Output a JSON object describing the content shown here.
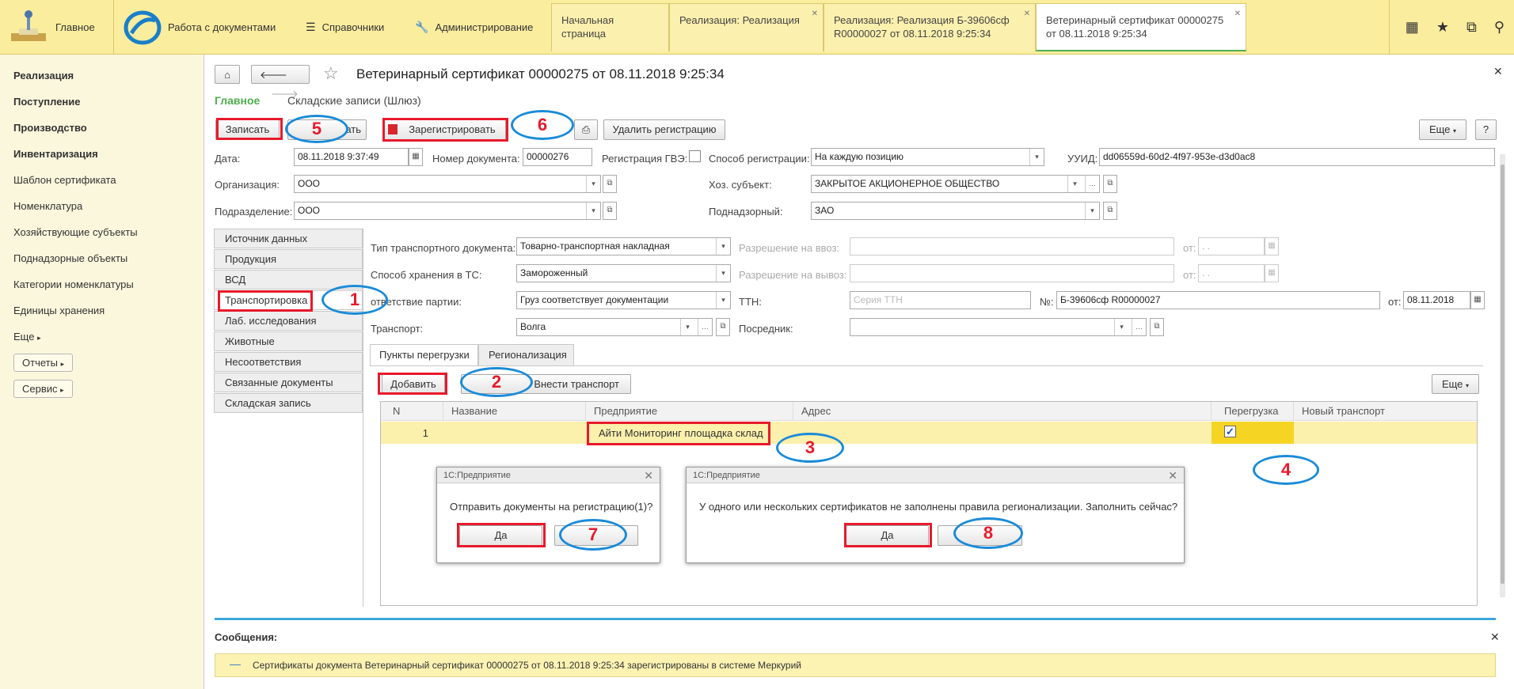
{
  "topbar": {
    "home": "Главное",
    "docs": "Работа с документами",
    "refs": "Справочники",
    "admin": "Администрирование",
    "tabs": [
      {
        "l1": "Начальная страница",
        "l2": ""
      },
      {
        "l1": "Реализация: Реализация",
        "l2": ""
      },
      {
        "l1": "Реализация: Реализация Б-39606сф",
        "l2": "R00000027 от 08.11.2018 9:25:34"
      },
      {
        "l1": "Ветеринарный сертификат 00000275",
        "l2": "от 08.11.2018 9:25:34"
      }
    ]
  },
  "leftnav": {
    "items": [
      "Реализация",
      "Поступление",
      "Производство",
      "Инвентаризация",
      "Шаблон сертификата",
      "Номенклатура",
      "Хозяйствующие субъекты",
      "Поднадзорные объекты",
      "Категории номенклатуры",
      "Единицы хранения",
      "Еще"
    ],
    "reports": "Отчеты",
    "service": "Сервис"
  },
  "form": {
    "title": "Ветеринарный сертификат 00000275 от 08.11.2018 9:25:34",
    "tab_main": "Главное",
    "tab_warehouse": "Складские записи (Шлюз)",
    "btn_write": "Записать",
    "btn_post_tail": "ать",
    "btn_register": "Зарегистрировать",
    "btn_unregister": "Удалить регистрацию",
    "btn_more": "Еще",
    "btn_help": "?",
    "date_label": "Дата:",
    "date_value": "08.11.2018  9:37:49",
    "docnum_label": "Номер документа:",
    "docnum_value": "00000276",
    "gvz_label": "Регистрация ГВЭ:",
    "regway_label": "Способ регистрации:",
    "regway_value": "На каждую позицию",
    "uuid_label": "УУИД:",
    "uuid_value": "dd06559d-60d2-4f97-953e-d3d0ac8",
    "org_label": "Организация:",
    "org_value": "ООО",
    "subject_label": "Хоз. субъект:",
    "subject_value": "ЗАКРЫТОЕ АКЦИОНЕРНОЕ ОБЩЕСТВО",
    "dept_label": "Подразделение:",
    "dept_value": "ООО",
    "supervised_label": "Поднадзорный:",
    "supervised_value": "ЗАО"
  },
  "sidetabs": [
    "Источник данных",
    "Продукция",
    "ВСД",
    "Транспортировка",
    "Лаб. исследования",
    "Животные",
    "Несоответствия",
    "Связанные документы",
    "Складская запись"
  ],
  "transport": {
    "doctype_label": "Тип транспортного документа:",
    "doctype_value": "Товарно-транспортная накладная",
    "storage_label": "Способ хранения в ТС:",
    "storage_value": "Замороженный",
    "match_label": "ответствие партии:",
    "match_value": "Груз соответствует документации",
    "vehicle_label": "Транспорт:",
    "vehicle_value": "Волга",
    "import_label": "Разрешение на ввоз:",
    "export_label": "Разрешение на вывоз:",
    "from_label": "от:",
    "date_placeholder": " .  .",
    "ttn_label": "ТТН:",
    "ttn_placeholder": "Серия ТТН",
    "num_label": "№:",
    "num_value": "Б-39606сф  R00000027",
    "ttn_date": "08.11.2018",
    "broker_label": "Посредник:",
    "subtab1": "Пункты перегрузки",
    "subtab2": "Регионализация",
    "btn_add": "Добавить",
    "btn_addtransport": "Внести транспорт",
    "btn_more": "Еще"
  },
  "table": {
    "headers": [
      "N",
      "Название",
      "Предприятие",
      "Адрес",
      "Перегрузка",
      "Новый транспорт"
    ],
    "row": {
      "n": "1",
      "name": "",
      "enterprise": "Айти Мониторинг площадка склад",
      "address": ""
    }
  },
  "dialog1": {
    "title": "1С:Предприятие",
    "text": "Отправить документы на регистрацию(1)?",
    "yes": "Да"
  },
  "dialog2": {
    "title": "1С:Предприятие",
    "text": "У одного или нескольких сертификатов не заполнены правила регионализации. Заполнить сейчас?",
    "yes": "Да"
  },
  "messages": {
    "title": "Сообщения:",
    "text": "Сертификаты документа Ветеринарный сертификат 00000275 от 08.11.2018 9:25:34 зарегистрированы в системе Меркурий"
  },
  "annotations": [
    "1",
    "2",
    "3",
    "4",
    "5",
    "6",
    "7",
    "8"
  ],
  "colors": {
    "accent_green": "#4fae4f",
    "annotation_red": "#e8192c",
    "annotation_blue": "#1a8bd8",
    "topbar": "#fbed9e",
    "row_highlight": "#fbf0ac"
  }
}
